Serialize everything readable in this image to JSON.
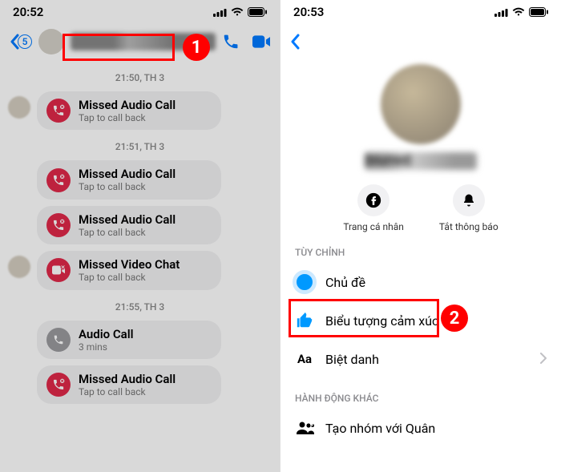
{
  "left": {
    "status": {
      "time": "20:52"
    },
    "header": {
      "back_badge": "5",
      "contact_name": "[blurred]"
    },
    "dividers": {
      "d1": "21:50, TH 3",
      "d2": "21:51, TH 3",
      "d3": "21:55, TH 3"
    },
    "items": [
      {
        "title": "Missed Audio Call",
        "sub": "Tap to call back"
      },
      {
        "title": "Missed Audio Call",
        "sub": "Tap to call back"
      },
      {
        "title": "Missed Audio Call",
        "sub": "Tap to call back"
      },
      {
        "title": "Missed Video Chat",
        "sub": "Tap to call back"
      },
      {
        "title": "Audio Call",
        "sub": "3 mins"
      },
      {
        "title": "Missed Audio Call",
        "sub": "Tap to call back"
      }
    ]
  },
  "right": {
    "status": {
      "time": "20:53"
    },
    "profile_name": "[blurred]",
    "actions": {
      "profile": "Trang cá nhân",
      "mute": "Tắt thông báo"
    },
    "sections": {
      "customize": "TÙY CHỈNH",
      "other": "HÀNH ĐỘNG KHÁC"
    },
    "rows": {
      "theme": "Chủ đề",
      "emoji": "Biểu tượng cảm xúc",
      "nickname": "Biệt danh",
      "create_group": "Tạo nhóm với Quân"
    }
  },
  "markers": {
    "one": "1",
    "two": "2"
  }
}
